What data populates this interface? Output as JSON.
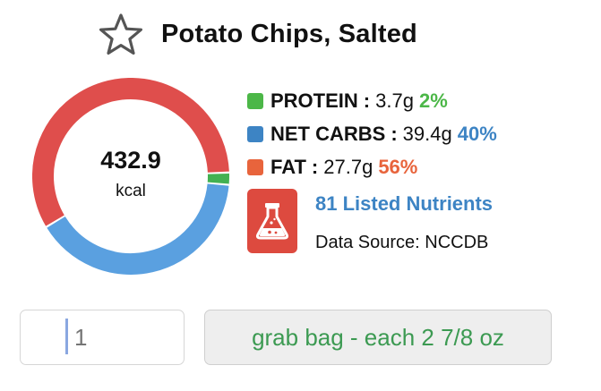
{
  "food": {
    "title": "Potato Chips, Salted",
    "star_icon": "star-outline-icon"
  },
  "calories": {
    "value": "432.9",
    "unit": "kcal"
  },
  "macros": [
    {
      "name": "PROTEIN",
      "sep": ":",
      "amount": "3.7g",
      "percent": "2%",
      "fraction": 0.02,
      "color": "#4cb748"
    },
    {
      "name": "NET CARBS",
      "sep": ":",
      "amount": "39.4g",
      "percent": "40%",
      "fraction": 0.4,
      "color": "#3d84c4"
    },
    {
      "name": "FAT",
      "sep": ":",
      "amount": "27.7g",
      "percent": "56%",
      "fraction": 0.56,
      "color": "#e8643c"
    }
  ],
  "ring_colors": {
    "protein": "#43b152",
    "carbs": "#5aa0e0",
    "fat": "#df4e4c"
  },
  "nutrients": {
    "icon": "flask-icon",
    "link_label": "81 Listed Nutrients",
    "source_label": "Data Source: NCCDB",
    "badge_color": "#dd4a3f"
  },
  "serving": {
    "quantity_value": "",
    "quantity_placeholder": "1",
    "unit_label": "grab bag - each 2 7/8 oz"
  }
}
